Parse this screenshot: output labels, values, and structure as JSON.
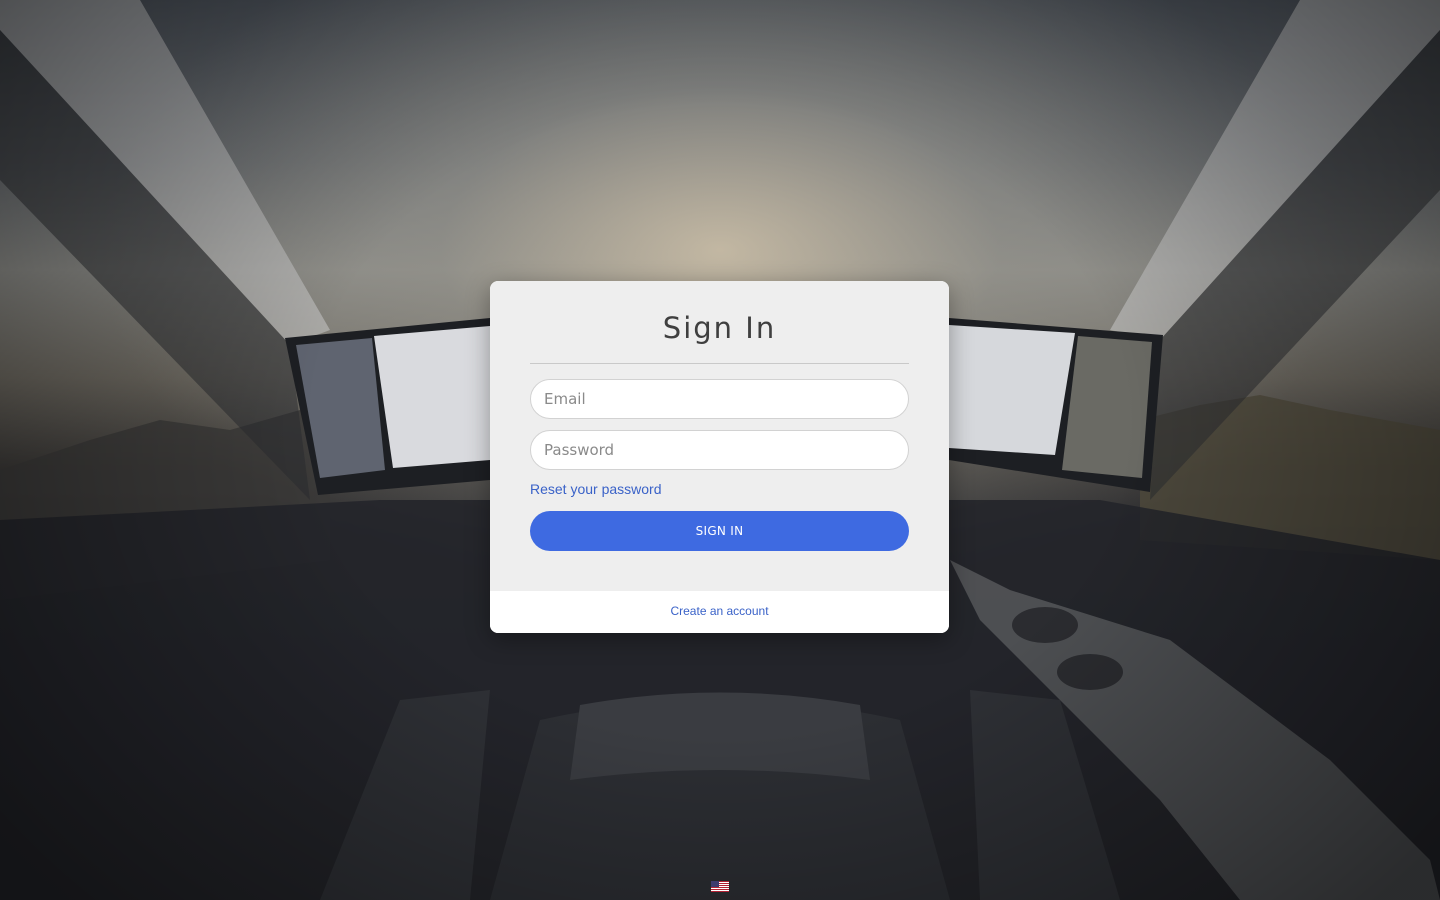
{
  "signin": {
    "title": "Sign In",
    "email_placeholder": "Email",
    "email_value": "",
    "password_placeholder": "Password",
    "password_value": "",
    "reset_link": "Reset your password",
    "submit_label": "SIGN IN",
    "create_account_link": "Create an account"
  },
  "footer": {
    "language_icon": "us-flag-icon"
  },
  "colors": {
    "accent": "#3e6ae1",
    "link": "#3a62c8",
    "card_bg": "#eeeeee",
    "footer_bg": "#ffffff",
    "title_text": "#3f3f3f"
  }
}
